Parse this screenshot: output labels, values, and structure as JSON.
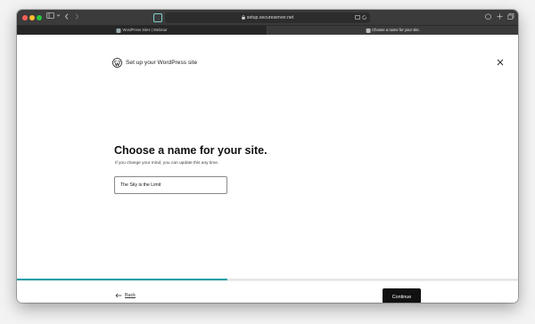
{
  "browser": {
    "url": "setup.secureserver.net",
    "tabs": [
      {
        "label": "WordPress Sites | Webinar",
        "active": false
      },
      {
        "label": "Choose a name for your site.",
        "active": true
      }
    ],
    "icons": [
      "sidebar-icon",
      "back-icon",
      "forward-icon",
      "lock-icon",
      "translate-icon",
      "reload-icon",
      "share-icon",
      "new-tab-icon",
      "tabs-overview-icon"
    ]
  },
  "header": {
    "title": "Set up your WordPress site",
    "logo": "wordpress-logo-icon",
    "close_icon": "close-icon"
  },
  "main": {
    "heading": "Choose a name for your site.",
    "subtext": "If you change your mind, you can update this any time.",
    "site_name_value": "The Sky is the Limit"
  },
  "progress": {
    "fraction": 0.42,
    "color": "#1a9ea8"
  },
  "footer": {
    "back_label": "Back",
    "continue_label": "Continue"
  },
  "colors": {
    "toolbar": "#3b3b3b",
    "primary_button": "#111111",
    "accent": "#1a9ea8"
  }
}
